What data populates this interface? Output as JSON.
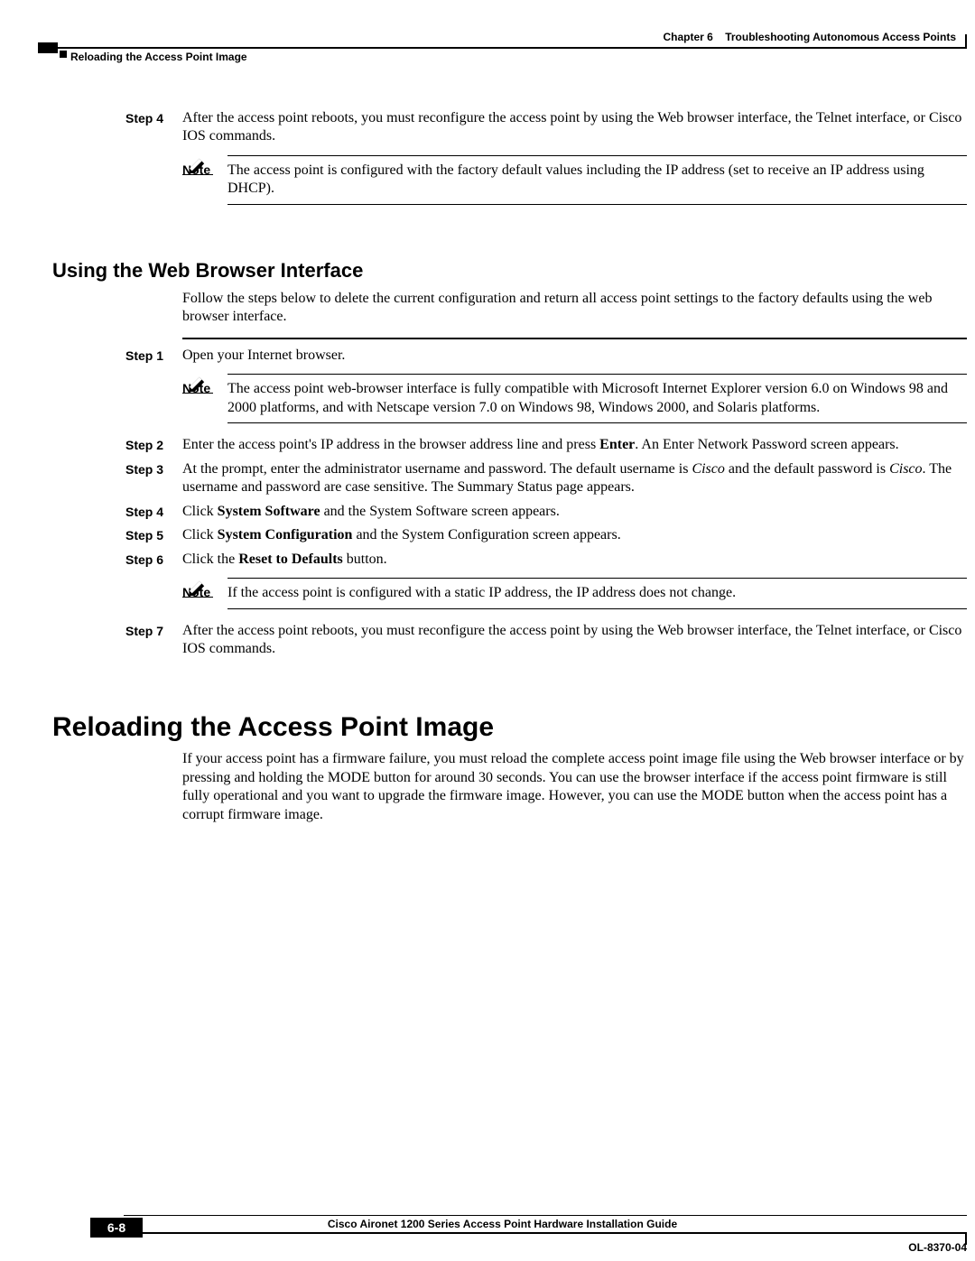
{
  "header": {
    "chapter_label": "Chapter 6",
    "chapter_title": "Troubleshooting Autonomous Access Points",
    "section": "Reloading the Access Point Image"
  },
  "top": {
    "step4_label": "Step 4",
    "step4_text": "After the access point reboots, you must reconfigure the access point by using the Web browser interface, the Telnet interface, or Cisco IOS commands.",
    "note_label": "Note",
    "note_text": "The access point is configured with the factory default values including the IP address (set to receive an IP address using DHCP)."
  },
  "web": {
    "heading": "Using the Web Browser Interface",
    "intro": "Follow the steps below to delete the current configuration and return all access point settings to the factory defaults using the web browser interface.",
    "step1_label": "Step 1",
    "step1_text": "Open your Internet browser.",
    "note1_label": "Note",
    "note1_text": "The access point web-browser interface is fully compatible with Microsoft Internet Explorer version 6.0 on Windows 98 and 2000 platforms, and with Netscape version 7.0 on Windows 98, Windows 2000, and Solaris platforms.",
    "step2_label": "Step 2",
    "step2_pre": "Enter the access point's IP address in the browser address line and press ",
    "step2_bold": "Enter",
    "step2_post": ". An Enter Network Password screen appears.",
    "step3_label": "Step 3",
    "step3_a": "At the prompt, enter the administrator username and password. The default username is ",
    "step3_cisco1": "Cisco",
    "step3_b": " and the default password is ",
    "step3_cisco2": "Cisco",
    "step3_c": ". The username and password are case sensitive. The Summary Status page appears.",
    "step4_label": "Step 4",
    "step4_a": "Click ",
    "step4_bold": "System Software",
    "step4_b": " and the System Software screen appears.",
    "step5_label": "Step 5",
    "step5_a": "Click ",
    "step5_bold": "System Configuration",
    "step5_b": " and the System Configuration screen appears.",
    "step6_label": "Step 6",
    "step6_a": "Click the ",
    "step6_bold": "Reset to Defaults",
    "step6_b": " button.",
    "note2_label": "Note",
    "note2_text": "If the access point is configured with a static IP address, the IP address does not change.",
    "step7_label": "Step 7",
    "step7_text": "After the access point reboots, you must reconfigure the access point by using the Web browser interface, the Telnet interface, or Cisco IOS commands."
  },
  "reload": {
    "heading": "Reloading the Access Point Image",
    "intro": "If your access point has a firmware failure, you must reload the complete access point image file using the Web browser interface or by pressing and holding the MODE button for around 30 seconds. You can use the browser interface if the access point firmware is still fully operational and you want to upgrade the firmware image. However, you can use the MODE button when the access point has a corrupt firmware image."
  },
  "footer": {
    "guide": "Cisco Aironet 1200 Series Access Point Hardware Installation Guide",
    "page": "6-8",
    "doc_id": "OL-8370-04"
  }
}
